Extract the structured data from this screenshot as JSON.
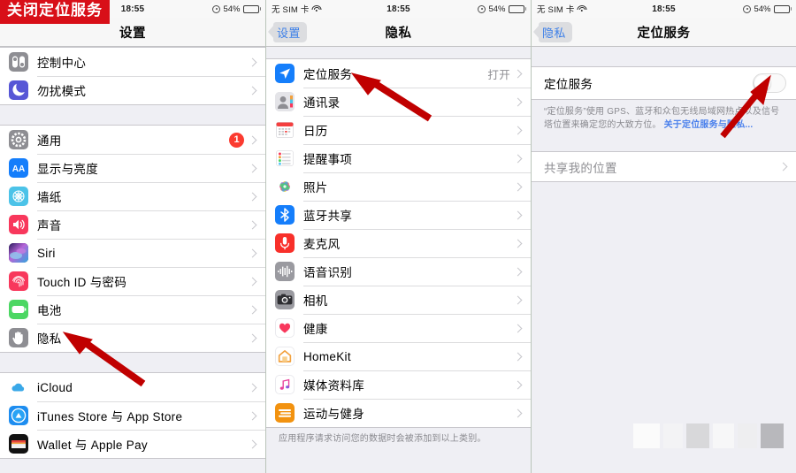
{
  "status_bar": {
    "carrier": "无 SIM 卡",
    "time": "18:55",
    "battery_percent": "54%",
    "wifi_icon": "wifi-icon",
    "location_icon": "location-arrow-icon",
    "battery_icon": "battery-icon"
  },
  "panel1": {
    "banner_text": "关闭定位服务",
    "nav_title": "设置",
    "groups": [
      {
        "rows": [
          {
            "label": "控制中心",
            "icon": "control-center-icon"
          },
          {
            "label": "勿扰模式",
            "icon": "do-not-disturb-moon-icon"
          }
        ]
      },
      {
        "rows": [
          {
            "label": "通用",
            "icon": "general-gear-icon",
            "badge": "1"
          },
          {
            "label": "显示与亮度",
            "icon": "display-brightness-icon"
          },
          {
            "label": "墙纸",
            "icon": "wallpaper-icon"
          },
          {
            "label": "声音",
            "icon": "sounds-speaker-icon"
          },
          {
            "label": "Siri",
            "icon": "siri-icon"
          },
          {
            "label": "Touch ID 与密码",
            "icon": "touch-id-icon"
          },
          {
            "label": "电池",
            "icon": "battery-settings-icon"
          },
          {
            "label": "隐私",
            "icon": "privacy-hand-icon"
          }
        ]
      },
      {
        "rows": [
          {
            "label": "iCloud",
            "icon": "icloud-icon"
          },
          {
            "label": "iTunes Store 与 App Store",
            "icon": "app-store-icon"
          },
          {
            "label": "Wallet 与 Apple Pay",
            "icon": "wallet-icon"
          }
        ]
      }
    ]
  },
  "panel2": {
    "nav_back": "设置",
    "nav_title": "隐私",
    "rows": [
      {
        "label": "定位服务",
        "icon": "location-services-icon",
        "value": "打开"
      },
      {
        "label": "通讯录",
        "icon": "contacts-icon",
        "value": ""
      },
      {
        "label": "日历",
        "icon": "calendar-icon",
        "value": ""
      },
      {
        "label": "提醒事项",
        "icon": "reminders-icon",
        "value": ""
      },
      {
        "label": "照片",
        "icon": "photos-icon",
        "value": ""
      },
      {
        "label": "蓝牙共享",
        "icon": "bluetooth-icon",
        "value": ""
      },
      {
        "label": "麦克风",
        "icon": "microphone-icon",
        "value": ""
      },
      {
        "label": "语音识别",
        "icon": "speech-recognition-icon",
        "value": ""
      },
      {
        "label": "相机",
        "icon": "camera-icon",
        "value": ""
      },
      {
        "label": "健康",
        "icon": "health-heart-icon",
        "value": ""
      },
      {
        "label": "HomeKit",
        "icon": "homekit-icon",
        "value": ""
      },
      {
        "label": "媒体资料库",
        "icon": "media-library-icon",
        "value": ""
      },
      {
        "label": "运动与健身",
        "icon": "motion-fitness-icon",
        "value": ""
      }
    ],
    "footnote": "应用程序请求访问您的数据时会被添加到以上类别。"
  },
  "panel3": {
    "nav_back": "隐私",
    "nav_title": "定位服务",
    "toggle_row_label": "定位服务",
    "toggle_state": "off",
    "description": "“定位服务”使用 GPS、蓝牙和众包无线局域网热点以及信号塔位置来确定您的大致方位。",
    "description_link": "关于定位服务与隐私...",
    "share_location_label": "共享我的位置"
  },
  "annotations": {
    "arrow1_target": "隐私",
    "arrow2_target": "定位服务",
    "arrow3_target": "定位服务开关",
    "arrow_color": "#c00000"
  }
}
